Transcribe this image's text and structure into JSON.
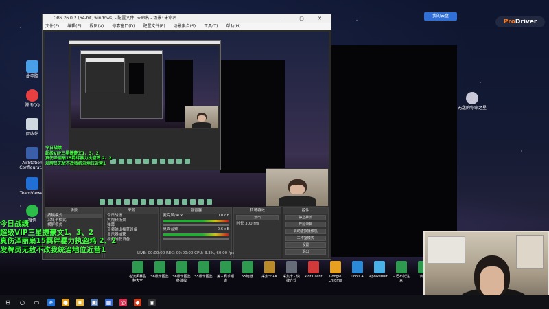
{
  "obs": {
    "title": "OBS 26.0.2 (64-bit, windows) - 配置文件: 未命名 - 场景: 未命名",
    "window_controls": "— ▢ ✕",
    "menus": [
      "文件(F)",
      "编辑(E)",
      "视图(V)",
      "停靠窗口(D)",
      "配置文件(P)",
      "场景集合(S)",
      "工具(T)",
      "帮助(H)"
    ],
    "preview_label": "未选择源",
    "docks": {
      "scenes": {
        "title": "场景",
        "items": [
          "按键模式",
          "采集卡模式",
          "横屏模式"
        ]
      },
      "sources": {
        "title": "来源",
        "items": [
          "今日战绩",
          "大视频场景",
          "弹幕",
          "音频输出捕获设备",
          "显示器捕获",
          "视频捕获设备"
        ]
      },
      "mixer": {
        "title": "混音器",
        "tracks": [
          "麦克风/Aux",
          "桌面音频"
        ],
        "levels": [
          "0.0 dB",
          "-0.6 dB"
        ]
      },
      "transitions": {
        "title": "转场特效",
        "type": "淡出",
        "duration_label": "时长",
        "duration": "300 ms"
      },
      "controls": {
        "title": "控件",
        "buttons": [
          "停止推流",
          "开始录制",
          "启动虚拟摄像机",
          "工作室模式",
          "设置",
          "退出"
        ]
      }
    },
    "status": "LIVE: 00:00:00   REC: 00:00:00   CPU: 3.3%, 60.00 fps"
  },
  "overlay": {
    "lines": [
      "今日战绩",
      "超级VIP三星捷豪文1、3、2",
      "真伤泽丽扇15羁绊暴力执盗鸡 2、2",
      "发牌员无敌不改我统治地位近营1"
    ],
    "small_lines": [
      "今日战绩",
      "超级VIP三星捷豪文1、3、2",
      "真伤泽丽扇15羁绊暴力执盗鸡 2、2",
      "发牌员无敌不改我统治地位近营1"
    ]
  },
  "desktop_icons": [
    {
      "label": "此电脑",
      "color": "#4aa0e8"
    },
    {
      "label": "腾讯QQ",
      "color": "#e84040"
    },
    {
      "label": "回收站",
      "color": "#cfd8e0"
    },
    {
      "label": "AirStation Configurat...",
      "color": "#3b5ea8"
    },
    {
      "label": "TeamViewer",
      "color": "#1f6fd6"
    },
    {
      "label": "微信",
      "color": "#2dbb4a"
    }
  ],
  "right_icon": {
    "label": "无敌的你命之星"
  },
  "top_badge": "我的云盘",
  "prodriver": {
    "p": "Pro",
    "rest": "Driver"
  },
  "shortcuts": [
    {
      "label": "名流风暴品种大全",
      "color": "#2e9a4f"
    },
    {
      "label": "S6最卡图鉴",
      "color": "#2e9a4f"
    },
    {
      "label": "S6最卡图鉴 终体模",
      "color": "#2e9a4f"
    },
    {
      "label": "S5最卡图鉴",
      "color": "#2e9a4f"
    },
    {
      "label": "第三赛季顺道",
      "color": "#2e9a4f"
    },
    {
      "label": "S5箱道",
      "color": "#2e9a4f"
    },
    {
      "label": "采集卡 4K",
      "color": "#b88a2a"
    },
    {
      "label": "采集卡 · 快捷方式",
      "color": "#666c78"
    },
    {
      "label": "Riot Client",
      "color": "#d23a3a"
    },
    {
      "label": "Google Chrome",
      "color": "#e8a020"
    },
    {
      "label": "iTools 4",
      "color": "#2a8ad8"
    },
    {
      "label": "ApowerMir...",
      "color": "#4ab0e8"
    },
    {
      "label": "三巴布防注意",
      "color": "#2e9a4f"
    },
    {
      "label": "表哥",
      "color": "#2e9a4f"
    }
  ],
  "taskbar": {
    "start": "⊞",
    "items": [
      {
        "name": "search",
        "glyph": "○",
        "color": "transparent"
      },
      {
        "name": "taskview",
        "glyph": "▭",
        "color": "transparent"
      },
      {
        "name": "edge",
        "glyph": "e",
        "color": "#1f6fd6"
      },
      {
        "name": "chrome",
        "glyph": "●",
        "color": "#e0a020"
      },
      {
        "name": "explorer",
        "glyph": "▪",
        "color": "#e6b840"
      },
      {
        "name": "photos",
        "glyph": "▣",
        "color": "#5a7ab0"
      },
      {
        "name": "store",
        "glyph": "▦",
        "color": "#3a6ad0"
      },
      {
        "name": "app1",
        "glyph": "◎",
        "color": "#d83050"
      },
      {
        "name": "app2",
        "glyph": "◆",
        "color": "#d04020"
      },
      {
        "name": "obs",
        "glyph": "◉",
        "color": "#333"
      }
    ]
  }
}
